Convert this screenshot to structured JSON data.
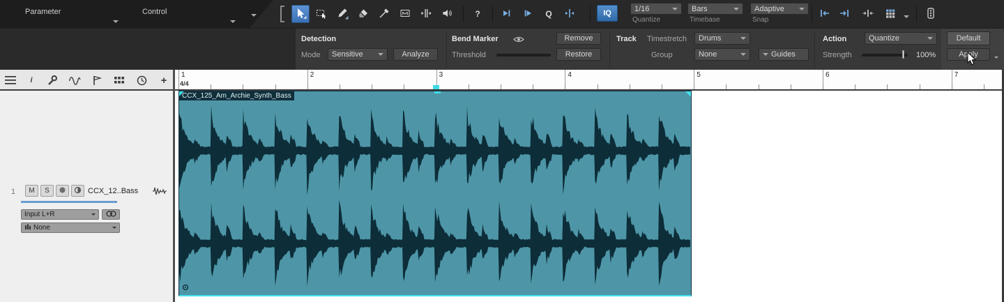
{
  "menubar": {
    "parameter_label": "Parameter",
    "control_label": "Control"
  },
  "icons": {
    "help_glyph": "?",
    "quantize_glyph": "Q",
    "info_glyph": "i",
    "add_glyph": "+"
  },
  "toolbar": {
    "iq_label": "IQ",
    "quantize": {
      "value": "1/16",
      "label": "Quantize"
    },
    "timebase": {
      "value": "Bars",
      "label": "Timebase"
    },
    "snap": {
      "value": "Adaptive",
      "label": "Snap"
    }
  },
  "bend_panel": {
    "detection": {
      "title": "Detection",
      "mode_label": "Mode",
      "mode_value": "Sensitive",
      "analyze_label": "Analyze"
    },
    "bend_marker": {
      "title": "Bend Marker",
      "threshold_label": "Threshold",
      "remove_label": "Remove",
      "restore_label": "Restore"
    },
    "track": {
      "title": "Track",
      "timestretch_label": "Timestretch",
      "timestretch_value": "Drums",
      "group_label": "Group",
      "group_value": "None",
      "guides_label": "Guides"
    },
    "action": {
      "title": "Action",
      "action_value": "Quantize",
      "default_label": "Default",
      "strength_label": "Strength",
      "strength_value": "100%",
      "apply_label": "Apply"
    }
  },
  "ruler": {
    "time_signature": "4/4",
    "bar_numbers": [
      "1",
      "2",
      "3",
      "4",
      "5",
      "6",
      "7"
    ]
  },
  "track_list": {
    "track_number": "1",
    "mute_label": "M",
    "solo_label": "S",
    "track_name": "CCX_12..Bass",
    "input_value": "Input L+R",
    "insert_value": "None"
  },
  "clip": {
    "name": "CCX_125_Am_Archie_Synth_Bass"
  },
  "colors": {
    "clip_body": "#4e96a7",
    "waveform": "#0d2d39",
    "selection": "#45e0ec",
    "tool_active": "#3f7fc4"
  }
}
